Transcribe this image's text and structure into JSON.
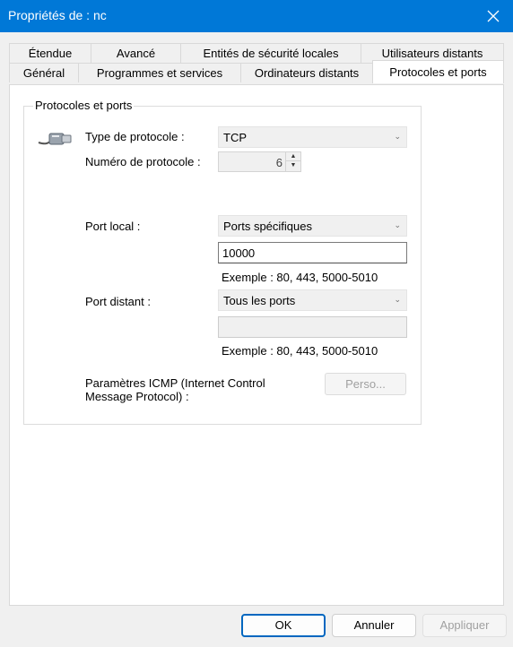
{
  "window": {
    "title": "Propriétés de : nc"
  },
  "tabs": {
    "row1": [
      "Étendue",
      "Avancé",
      "Entités de sécurité locales",
      "Utilisateurs distants"
    ],
    "row2": [
      "Général",
      "Programmes et services",
      "Ordinateurs distants",
      "Protocoles et ports"
    ],
    "selected": "Protocoles et ports"
  },
  "group": {
    "title": "Protocoles et ports",
    "protocol_type_label": "Type de protocole :",
    "protocol_type_value": "TCP",
    "protocol_number_label": "Numéro de protocole :",
    "protocol_number_value": "6",
    "local_port_label": "Port local :",
    "local_port_mode": "Ports spécifiques",
    "local_port_value": "10000",
    "local_port_example": "Exemple : 80, 443, 5000-5010",
    "remote_port_label": "Port distant :",
    "remote_port_mode": "Tous les ports",
    "remote_port_value": "",
    "remote_port_example": "Exemple : 80, 443, 5000-5010",
    "icmp_label_line1": "Paramètres ICMP (Internet Control",
    "icmp_label_line2": "Message Protocol) :",
    "icmp_button": "Perso..."
  },
  "footer": {
    "ok": "OK",
    "cancel": "Annuler",
    "apply": "Appliquer"
  },
  "icons": {
    "close": "close-icon",
    "protocol": "network-plug-icon",
    "dropdown": "chevron-down-icon"
  },
  "colors": {
    "titlebar": "#0078d7",
    "default_button_border": "#0067c0"
  }
}
